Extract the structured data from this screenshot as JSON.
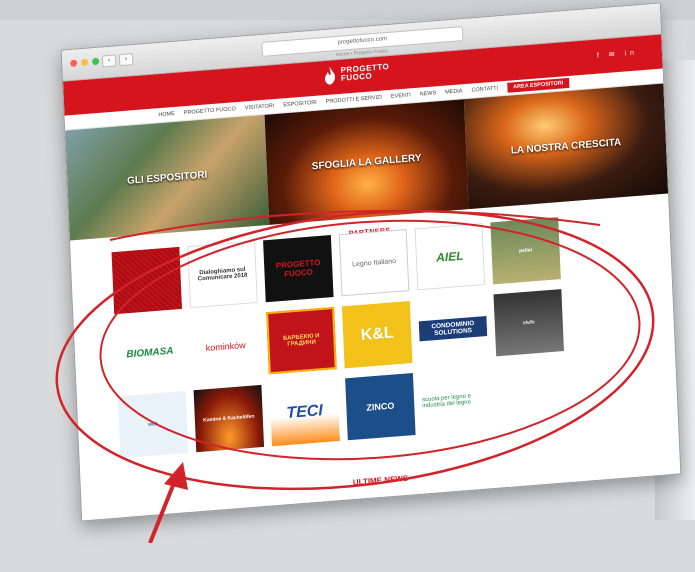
{
  "browser": {
    "url": "progettofuoco.com",
    "tab_text": "Home • Progetto Fuoco"
  },
  "site": {
    "logo_line1": "PROGETTO",
    "logo_line2": "FUOCO",
    "head_icons": "f ✉ in"
  },
  "menu": {
    "items": [
      "HOME",
      "PROGETTO FUOCO",
      "VISITATORI",
      "ESPOSITORI",
      "PRODOTTI E SERVIZI",
      "EVENTI",
      "NEWS",
      "MEDIA",
      "CONTATTI"
    ],
    "exhibitor_button": "AREA ESPOSITORI"
  },
  "banners": {
    "left": "GLI ESPOSITORI",
    "middle": "SFOGLIA LA GALLERY",
    "right": "LA NOSTRA CRESCITA"
  },
  "partners": {
    "title": "PARTNERS",
    "tiles": [
      {
        "id": "t1",
        "label": ""
      },
      {
        "id": "t2",
        "label": "Dialoghiamo sul Comunicare 2018"
      },
      {
        "id": "t3",
        "label": "PROGETTO FUOCO"
      },
      {
        "id": "t4",
        "label": "Legno Italiano"
      },
      {
        "id": "t5",
        "label": "AIEL"
      },
      {
        "id": "t6",
        "label": "pellet"
      },
      {
        "id": "t7",
        "label": "BIOMASA"
      },
      {
        "id": "t8",
        "label": "kominków"
      },
      {
        "id": "t9",
        "label": "БАРБЕКЮ И ГРАДИНИ"
      },
      {
        "id": "t10",
        "label": "K&L"
      },
      {
        "id": "t11",
        "label": "CONDOMINIO SOLUTIONS"
      },
      {
        "id": "t12",
        "label": "stufe"
      },
      {
        "id": "t13",
        "label": "web"
      },
      {
        "id": "t14",
        "label": "Kamine & Kachelöfen"
      },
      {
        "id": "t15",
        "label": "TECI"
      },
      {
        "id": "t16",
        "label": "ZINCO"
      },
      {
        "id": "t17",
        "label": "scuola per legno e industria del legno"
      }
    ]
  },
  "news": {
    "title": "ULTIME NEWS"
  },
  "colors": {
    "brand_red": "#d6141e",
    "annotation_red": "#d2232a"
  }
}
